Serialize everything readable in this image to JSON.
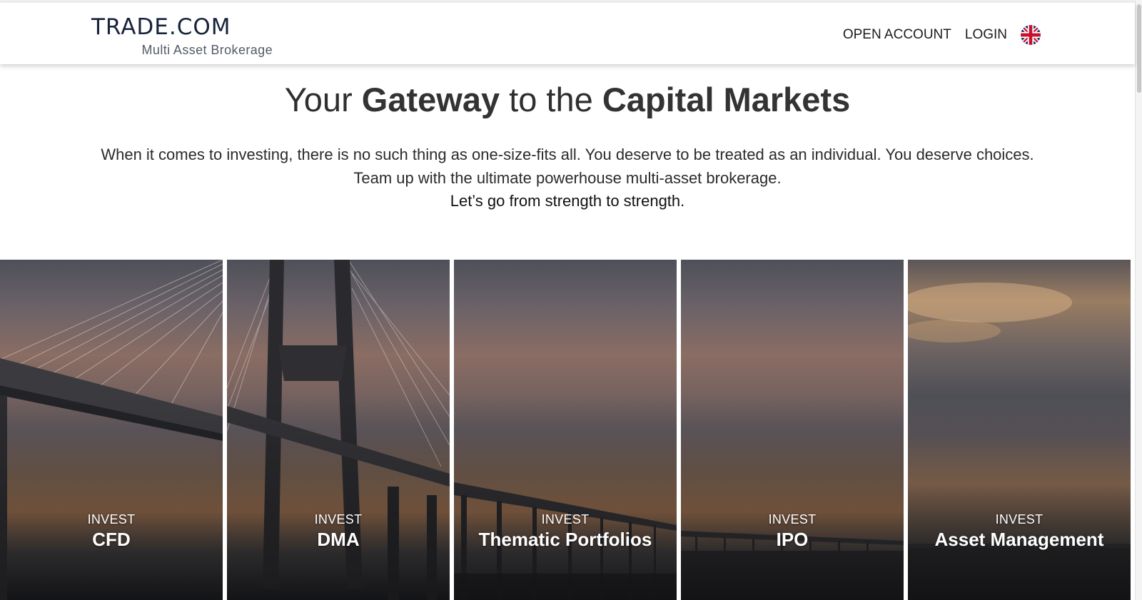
{
  "header": {
    "logo_main": "TRADE.COM",
    "logo_sub": "Multi Asset Brokerage",
    "nav": {
      "open_account": "OPEN ACCOUNT",
      "login": "LOGIN"
    },
    "language_icon": "uk-flag-icon"
  },
  "hero": {
    "headline_prefix": "Your ",
    "headline_bold_1": "Gateway",
    "headline_middle": " to the ",
    "headline_bold_2": "Capital Markets",
    "line_1": "When it comes to investing, there is no such thing as one-size-fits all. You deserve to be treated as an individual. You deserve choices.",
    "line_2": "Team up with the ultimate powerhouse multi-asset brokerage.",
    "line_3": "Let’s go from strength to strength."
  },
  "panels": [
    {
      "kicker": "INVEST",
      "title": "CFD"
    },
    {
      "kicker": "INVEST",
      "title": "DMA"
    },
    {
      "kicker": "INVEST",
      "title": "Thematic Portfolios"
    },
    {
      "kicker": "INVEST",
      "title": "IPO"
    },
    {
      "kicker": "INVEST",
      "title": "Asset Management"
    }
  ],
  "colors": {
    "brand_navy": "#17223b",
    "text_dark": "#2f2f2f",
    "sky_dusk": "#8a6d63"
  }
}
